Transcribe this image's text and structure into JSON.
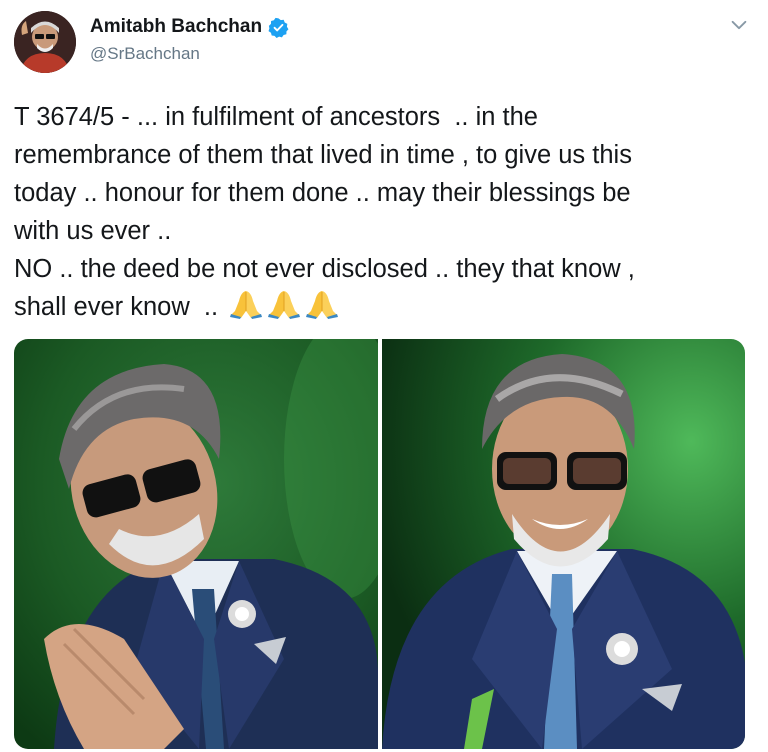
{
  "author": {
    "display_name": "Amitabh Bachchan",
    "handle": "@SrBachchan",
    "verified": true
  },
  "icons": {
    "verified": "verified-badge-icon",
    "menu": "chevron-down-icon",
    "emoji": "folded-hands-emoji"
  },
  "tweet": {
    "lines": [
      "T 3674/5 - ... in fulfilment of ancestors  .. in the",
      "remembrance of them that lived in time , to give us this",
      "today .. honour for them done .. may their blessings be",
      "with us ever ..",
      "NO .. the deed be not ever disclosed .. they that know ,",
      "shall ever know  .. "
    ],
    "emoji_count": 3
  },
  "colors": {
    "text": "#14171a",
    "secondary": "#657786",
    "verified": "#1da1f2"
  }
}
